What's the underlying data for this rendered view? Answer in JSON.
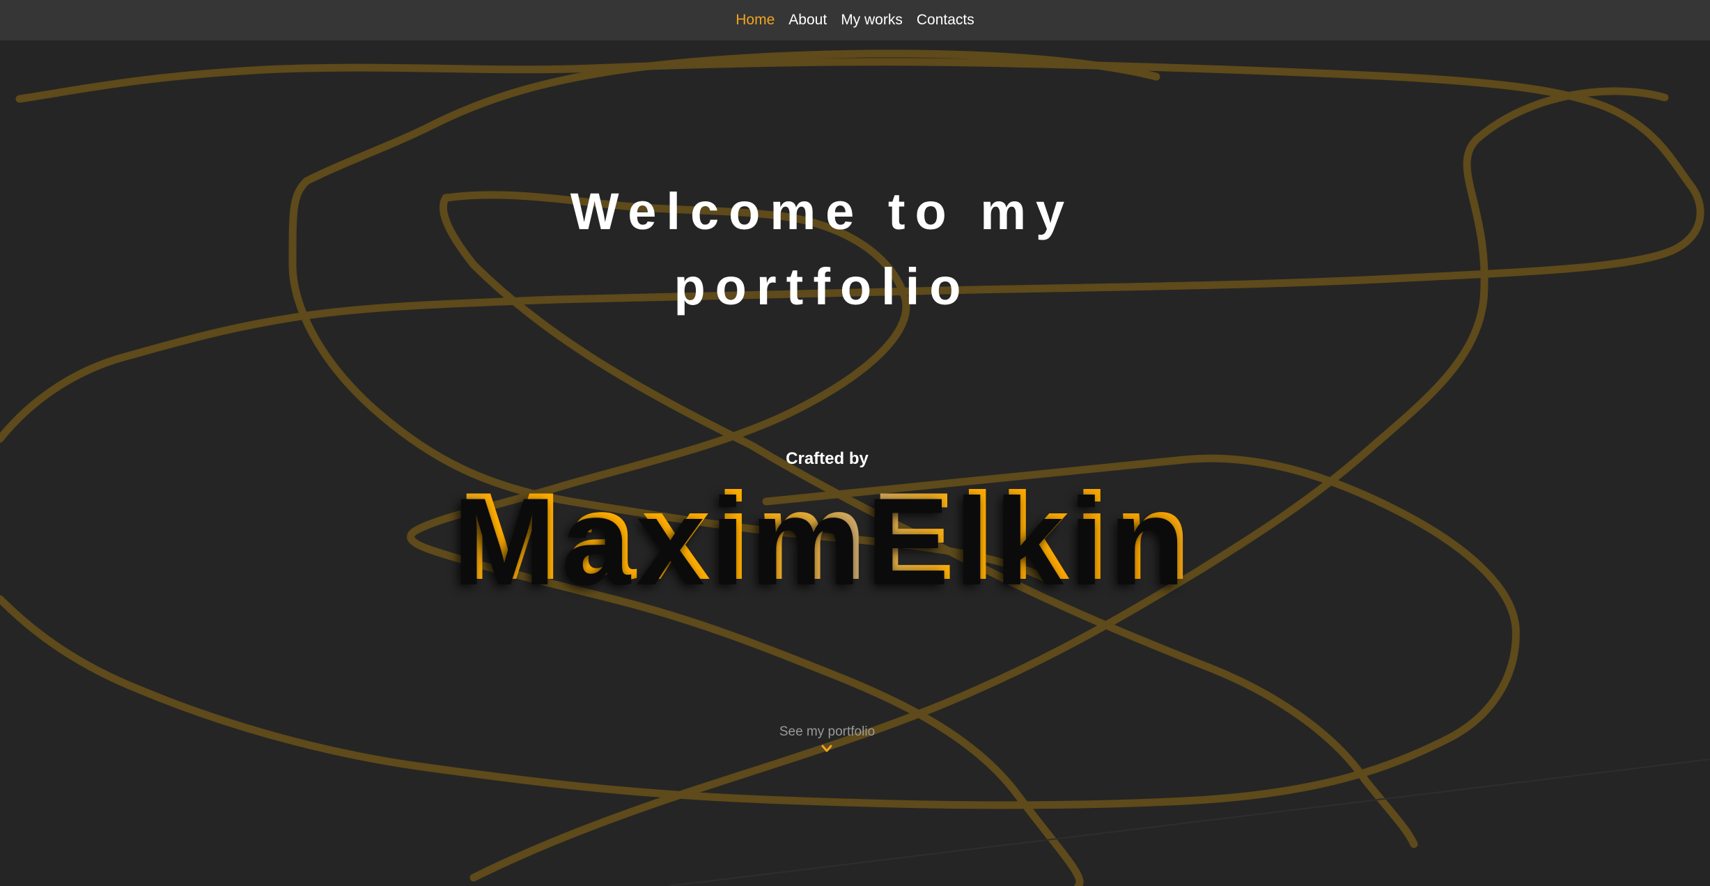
{
  "nav": {
    "items": [
      {
        "label": "Home",
        "active": true
      },
      {
        "label": "About",
        "active": false
      },
      {
        "label": "My works",
        "active": false
      },
      {
        "label": "Contacts",
        "active": false
      }
    ]
  },
  "hero": {
    "title_line1": "Welcome to my",
    "title_line2": "portfolio",
    "crafted_by": "Crafted by",
    "name": "MaximElkin",
    "cta_label": "See my portfolio"
  },
  "colors": {
    "background": "#252525",
    "nav_background": "#363636",
    "accent": "#f0a520",
    "scribble": "#5e4a1a",
    "text": "#ffffff",
    "muted": "#9a9a9a"
  },
  "icons": {
    "cta_icon": "chevron-down-icon"
  }
}
